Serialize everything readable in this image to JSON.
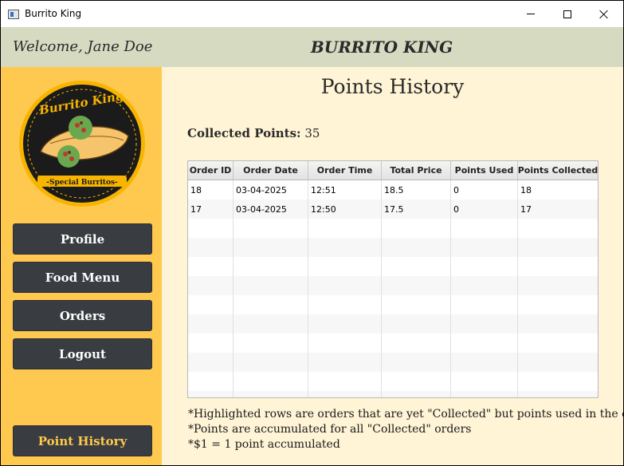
{
  "window": {
    "title": "Burrito King"
  },
  "header": {
    "welcome": "Welcome, Jane Doe",
    "brand": "BURRITO KING"
  },
  "sidebar": {
    "logo": {
      "top_text": "Burrito King",
      "bottom_text": "-Special Burritos-"
    },
    "items": [
      {
        "label": "Profile"
      },
      {
        "label": "Food Menu"
      },
      {
        "label": "Orders"
      },
      {
        "label": "Logout"
      }
    ],
    "active_item": {
      "label": "Point History"
    }
  },
  "main": {
    "title": "Points History",
    "collected_label": "Collected Points:",
    "collected_value": "35",
    "table": {
      "columns": [
        "Order ID",
        "Order Date",
        "Order Time",
        "Total Price",
        "Points Used",
        "Points Collected"
      ],
      "rows": [
        [
          "18",
          "03-04-2025",
          "12:51",
          "18.5",
          "0",
          "18"
        ],
        [
          "17",
          "03-04-2025",
          "12:50",
          "17.5",
          "0",
          "17"
        ]
      ]
    },
    "notes": [
      "*Highlighted rows are orders that are yet \"Collected\" but points used in the order",
      "*Points are accumulated for all \"Collected\" orders",
      "*$1 = 1 point accumulated"
    ]
  },
  "colors": {
    "sidebar": "#ffc94f",
    "header": "#d5dac1",
    "content": "#fff4d6",
    "button": "#393c40"
  }
}
